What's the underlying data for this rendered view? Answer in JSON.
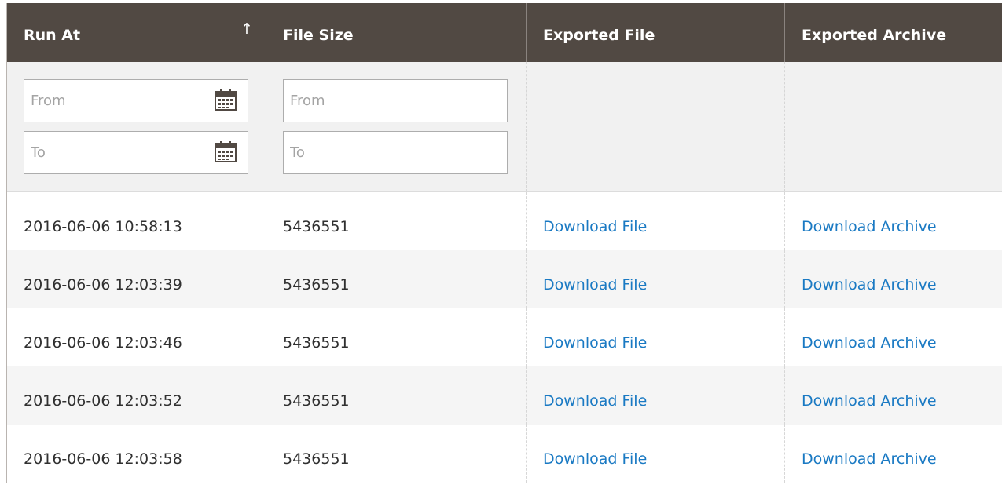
{
  "columns": {
    "run_at": "Run At",
    "file_size": "File Size",
    "exported_file": "Exported File",
    "exported_archive": "Exported Archive",
    "sort_indicator": "↑"
  },
  "filters": {
    "run_at_from_placeholder": "From",
    "run_at_to_placeholder": "To",
    "file_size_from_placeholder": "From",
    "file_size_to_placeholder": "To",
    "calendar_icon": "calendar-icon"
  },
  "rows": [
    {
      "run_at": "2016-06-06 10:58:13",
      "file_size": "5436551",
      "file_link": "Download File",
      "archive_link": "Download Archive"
    },
    {
      "run_at": "2016-06-06 12:03:39",
      "file_size": "5436551",
      "file_link": "Download File",
      "archive_link": "Download Archive"
    },
    {
      "run_at": "2016-06-06 12:03:46",
      "file_size": "5436551",
      "file_link": "Download File",
      "archive_link": "Download Archive"
    },
    {
      "run_at": "2016-06-06 12:03:52",
      "file_size": "5436551",
      "file_link": "Download File",
      "archive_link": "Download Archive"
    },
    {
      "run_at": "2016-06-06 12:03:58",
      "file_size": "5436551",
      "file_link": "Download File",
      "archive_link": "Download Archive"
    }
  ],
  "colors": {
    "header_bg": "#514943",
    "link": "#1979c3",
    "filter_bg": "#f1f1f1",
    "alt_row_bg": "#f5f5f5"
  }
}
